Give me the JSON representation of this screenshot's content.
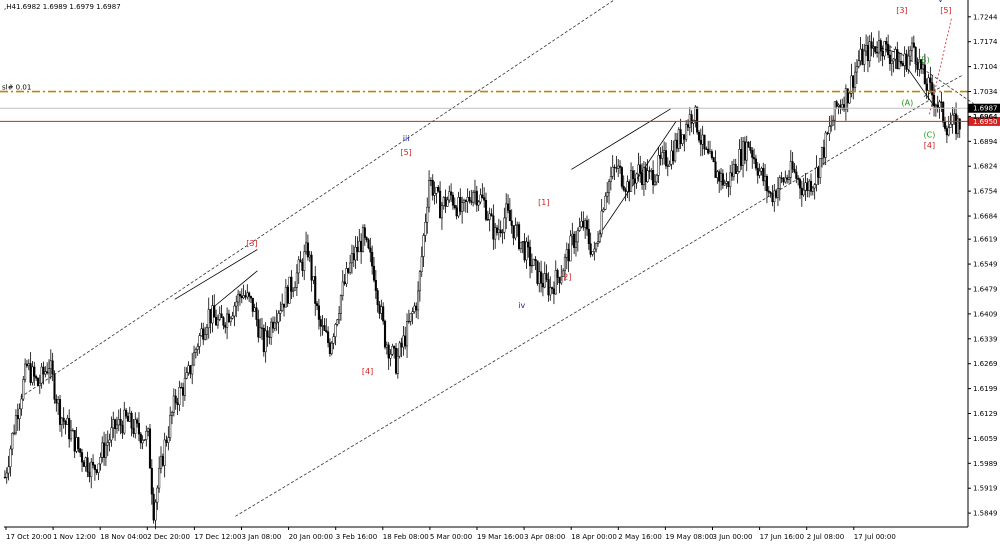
{
  "header": {
    "symbol_tf": ",H4",
    "ohlc": "1.6982 1.6989 1.6979 1.6987"
  },
  "level_label": "sl# 0.01",
  "chart_data": {
    "type": "candlestick",
    "ylim": [
      1.581,
      1.728
    ],
    "y_ticks": [
      "1.7244",
      "1.7174",
      "1.7104",
      "1.7034",
      "1.6964",
      "1.6894",
      "1.6824",
      "1.6754",
      "1.6684",
      "1.6619",
      "1.6549",
      "1.6479",
      "1.6409",
      "1.6339",
      "1.6269",
      "1.6199",
      "1.6129",
      "1.6059",
      "1.5989",
      "1.5919",
      "1.5849"
    ],
    "x_ticks": [
      "17 Oct 20:00",
      "1 Nov 12:00",
      "18 Nov 04:00",
      "2 Dec 20:00",
      "17 Dec 12:00",
      "3 Jan 08:00",
      "20 Jan 00:00",
      "3 Feb 16:00",
      "18 Feb 08:00",
      "5 Mar 00:00",
      "19 Mar 16:00",
      "3 Apr 08:00",
      "18 Apr 00:00",
      "2 May 16:00",
      "19 May 08:00",
      "3 Jun 00:00",
      "17 Jun 16:00",
      "2 Jul 08:00",
      "17 Jul 00:00"
    ],
    "price_path": [
      [
        0,
        1.595
      ],
      [
        2,
        1.612
      ],
      [
        4,
        1.626
      ],
      [
        6,
        1.621
      ],
      [
        8,
        1.627
      ],
      [
        10,
        1.613
      ],
      [
        12,
        1.607
      ],
      [
        14,
        1.601
      ],
      [
        16,
        1.597
      ],
      [
        18,
        1.603
      ],
      [
        20,
        1.609
      ],
      [
        22,
        1.611
      ],
      [
        24,
        1.608
      ],
      [
        26,
        1.606
      ],
      [
        27,
        1.586
      ],
      [
        29,
        1.604
      ],
      [
        31,
        1.617
      ],
      [
        33,
        1.622
      ],
      [
        35,
        1.633
      ],
      [
        37,
        1.641
      ],
      [
        39,
        1.638
      ],
      [
        41,
        1.642
      ],
      [
        43,
        1.647
      ],
      [
        45,
        1.643
      ],
      [
        47,
        1.632
      ],
      [
        49,
        1.641
      ],
      [
        51,
        1.646
      ],
      [
        53,
        1.652
      ],
      [
        55,
        1.659
      ],
      [
        57,
        1.638
      ],
      [
        59,
        1.632
      ],
      [
        61,
        1.646
      ],
      [
        63,
        1.656
      ],
      [
        65,
        1.662
      ],
      [
        67,
        1.653
      ],
      [
        69,
        1.634
      ],
      [
        71,
        1.627
      ],
      [
        73,
        1.636
      ],
      [
        75,
        1.646
      ],
      [
        77,
        1.679
      ],
      [
        79,
        1.671
      ],
      [
        81,
        1.674
      ],
      [
        83,
        1.669
      ],
      [
        85,
        1.676
      ],
      [
        87,
        1.672
      ],
      [
        89,
        1.663
      ],
      [
        91,
        1.669
      ],
      [
        93,
        1.663
      ],
      [
        95,
        1.657
      ],
      [
        97,
        1.651
      ],
      [
        99,
        1.648
      ],
      [
        101,
        1.653
      ],
      [
        103,
        1.661
      ],
      [
        105,
        1.666
      ],
      [
        107,
        1.657
      ],
      [
        109,
        1.676
      ],
      [
        111,
        1.682
      ],
      [
        113,
        1.677
      ],
      [
        115,
        1.681
      ],
      [
        117,
        1.679
      ],
      [
        119,
        1.683
      ],
      [
        121,
        1.686
      ],
      [
        123,
        1.692
      ],
      [
        125,
        1.698
      ],
      [
        127,
        1.686
      ],
      [
        129,
        1.681
      ],
      [
        131,
        1.677
      ],
      [
        133,
        1.684
      ],
      [
        135,
        1.689
      ],
      [
        137,
        1.681
      ],
      [
        139,
        1.674
      ],
      [
        141,
        1.678
      ],
      [
        143,
        1.681
      ],
      [
        145,
        1.676
      ],
      [
        147,
        1.679
      ],
      [
        149,
        1.689
      ],
      [
        151,
        1.699
      ],
      [
        153,
        1.703
      ],
      [
        155,
        1.712
      ],
      [
        157,
        1.715
      ],
      [
        159,
        1.717
      ],
      [
        161,
        1.713
      ],
      [
        163,
        1.711
      ],
      [
        165,
        1.716
      ],
      [
        167,
        1.706
      ],
      [
        169,
        1.701
      ],
      [
        171,
        1.694
      ]
    ],
    "horizontal_levels": [
      {
        "value": 1.7034,
        "color": "#b8860b",
        "style": "dash-dot",
        "label": "sl# 0.01"
      },
      {
        "value": 1.6987,
        "color": "#c0c0c0",
        "style": "solid",
        "tag": "1.6987",
        "tag_bg": "#000000"
      },
      {
        "value": 1.695,
        "color": "#d22222",
        "style": "solid",
        "tag": "1.6950",
        "tag_bg": "#d22222"
      }
    ],
    "extra_price_labels": [
      "1.6964"
    ],
    "wave_labels": [
      {
        "text": "[3]",
        "i": 45,
        "p": 1.66,
        "color": "#d22222"
      },
      {
        "text": "iii",
        "i": 73,
        "p": 1.6895,
        "color": "#1f1fb0"
      },
      {
        "text": "[5]",
        "i": 73,
        "p": 1.6855,
        "color": "#d22222"
      },
      {
        "text": "[4]",
        "i": 66,
        "p": 1.624,
        "color": "#d22222"
      },
      {
        "text": "[1]",
        "i": 98,
        "p": 1.6715,
        "color": "#d22222"
      },
      {
        "text": "[2]",
        "i": 102,
        "p": 1.6505,
        "color": "#d22222"
      },
      {
        "text": "iv",
        "i": 94,
        "p": 1.6425,
        "color": "#1f1fb0"
      },
      {
        "text": "[3]",
        "i": 163,
        "p": 1.7255,
        "color": "#d22222"
      },
      {
        "text": "v",
        "i": 170,
        "p": 1.7285,
        "color": "#1f1fb0"
      },
      {
        "text": "[5]",
        "i": 171,
        "p": 1.7255,
        "color": "#d22222"
      },
      {
        "text": "(B)",
        "i": 167,
        "p": 1.7115,
        "color": "#1f9a1f"
      },
      {
        "text": "(A)",
        "i": 164,
        "p": 1.6995,
        "color": "#1f9a1f"
      },
      {
        "text": "(C)",
        "i": 168,
        "p": 1.6905,
        "color": "#1f9a1f"
      },
      {
        "text": "[4]",
        "i": 168,
        "p": 1.6875,
        "color": "#d22222"
      }
    ],
    "channel_lines": [
      {
        "from": [
          3,
          1.6175
        ],
        "to": [
          128,
          1.747
        ],
        "dash": true
      },
      {
        "from": [
          42,
          1.584
        ],
        "to": [
          168,
          1.701
        ],
        "dash": true
      },
      {
        "from": [
          160,
          1.717
        ],
        "to": [
          176,
          1.7
        ],
        "dash": true
      },
      {
        "from": [
          167,
          1.702
        ],
        "to": [
          174,
          1.708
        ],
        "dash": true
      }
    ],
    "trend_lines": [
      {
        "from": [
          31,
          1.645
        ],
        "to": [
          46,
          1.659
        ]
      },
      {
        "from": [
          37,
          1.6415
        ],
        "to": [
          46,
          1.653
        ]
      },
      {
        "from": [
          103,
          1.6815
        ],
        "to": [
          121,
          1.6985
        ]
      },
      {
        "from": [
          108,
          1.663
        ],
        "to": [
          122,
          1.695
        ]
      },
      {
        "from": [
          157,
          1.7165
        ],
        "to": [
          163,
          1.714
        ]
      },
      {
        "from": [
          164,
          1.71
        ],
        "to": [
          169,
          1.699
        ]
      }
    ],
    "forecast_line": {
      "from": [
        168,
        1.697
      ],
      "to": [
        172,
        1.724
      ],
      "color": "#d22222"
    }
  }
}
